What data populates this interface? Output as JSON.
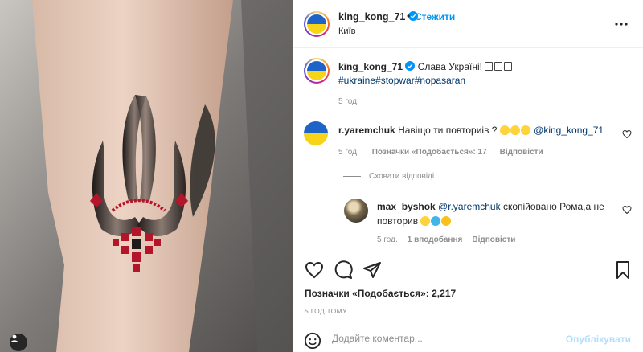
{
  "header": {
    "username": "king_kong_71",
    "separator": "•",
    "follow_label": "Стежити",
    "location": "Київ"
  },
  "caption": {
    "username": "king_kong_71",
    "text": "Слава Україні!",
    "hashtags": "#ukraine#stopwar#nopasaran",
    "time": "5 год."
  },
  "comment": {
    "username": "r.yaremchuk",
    "text": "Навіщо ти повториів ?",
    "mention": "@king_kong_71",
    "time": "5 год.",
    "likes": "Позначки «Подобається»: 17",
    "reply_label": "Відповісти",
    "hide_replies_label": "Сховати відповіді"
  },
  "reply": {
    "username": "max_byshok",
    "mention": "@r.yaremchuk",
    "text": "скопійовано Рома,а не повторив",
    "time": "5 год.",
    "likes": "1 вподобання",
    "reply_label": "Відповісти"
  },
  "post": {
    "likes_text": "Позначки «Подобається»: 2,217",
    "time": "5 ГОД ТОМУ"
  },
  "comment_bar": {
    "placeholder": "Додайте коментар...",
    "publish_label": "Опублікувати"
  },
  "colors": {
    "accent": "#0095f6",
    "hashtag": "#00376b",
    "muted": "#8e8e8e",
    "flag_blue": "#1e64c8",
    "flag_yellow": "#f7d417"
  },
  "icons": [
    "verified-icon",
    "more-options-icon",
    "heart-icon",
    "comment-icon",
    "share-icon",
    "bookmark-icon",
    "emoji-icon",
    "user-tag-icon"
  ]
}
